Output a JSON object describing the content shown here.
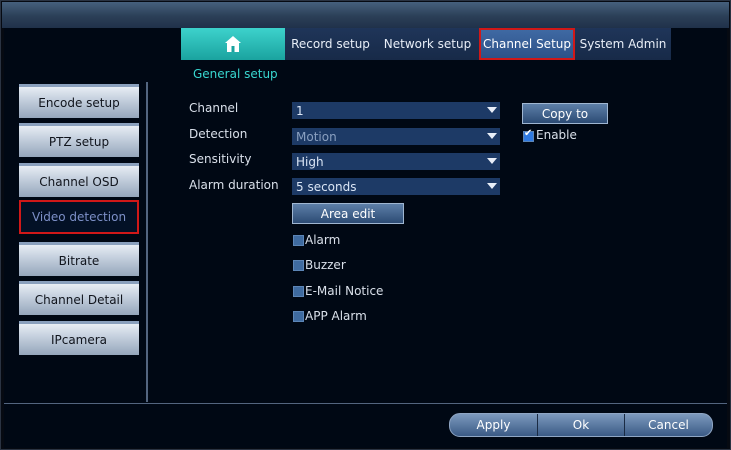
{
  "top_tabs": [
    {
      "label": "",
      "icon": "home-icon"
    },
    {
      "label": "Record setup"
    },
    {
      "label": "Network setup"
    },
    {
      "label": "Channel Setup",
      "selected": true
    },
    {
      "label": "System Admin"
    }
  ],
  "subtab": {
    "label": "General setup"
  },
  "sidebar": {
    "items": [
      {
        "label": "Encode setup"
      },
      {
        "label": "PTZ setup"
      },
      {
        "label": "Channel OSD"
      },
      {
        "label": "Video detection",
        "selected": true
      },
      {
        "label": "Bitrate"
      },
      {
        "label": "Channel Detail"
      },
      {
        "label": "IPcamera"
      }
    ]
  },
  "form": {
    "channel": {
      "label": "Channel",
      "value": "1"
    },
    "detection": {
      "label": "Detection",
      "value": "Motion"
    },
    "sensitivity": {
      "label": "Sensitivity",
      "value": "High"
    },
    "alarm_duration": {
      "label": "Alarm duration",
      "value": "5 seconds"
    },
    "copy_to": "Copy to",
    "enable": {
      "label": "Enable",
      "checked": true
    },
    "area_edit": "Area edit",
    "options": [
      {
        "label": "Alarm",
        "checked": false
      },
      {
        "label": "Buzzer",
        "checked": false
      },
      {
        "label": "E-Mail Notice",
        "checked": false
      },
      {
        "label": "APP Alarm",
        "checked": false
      }
    ]
  },
  "footer": {
    "apply": "Apply",
    "ok": "Ok",
    "cancel": "Cancel"
  },
  "colors": {
    "accent": "#1aa39f",
    "highlight": "#d01818",
    "panel": "#000814"
  }
}
